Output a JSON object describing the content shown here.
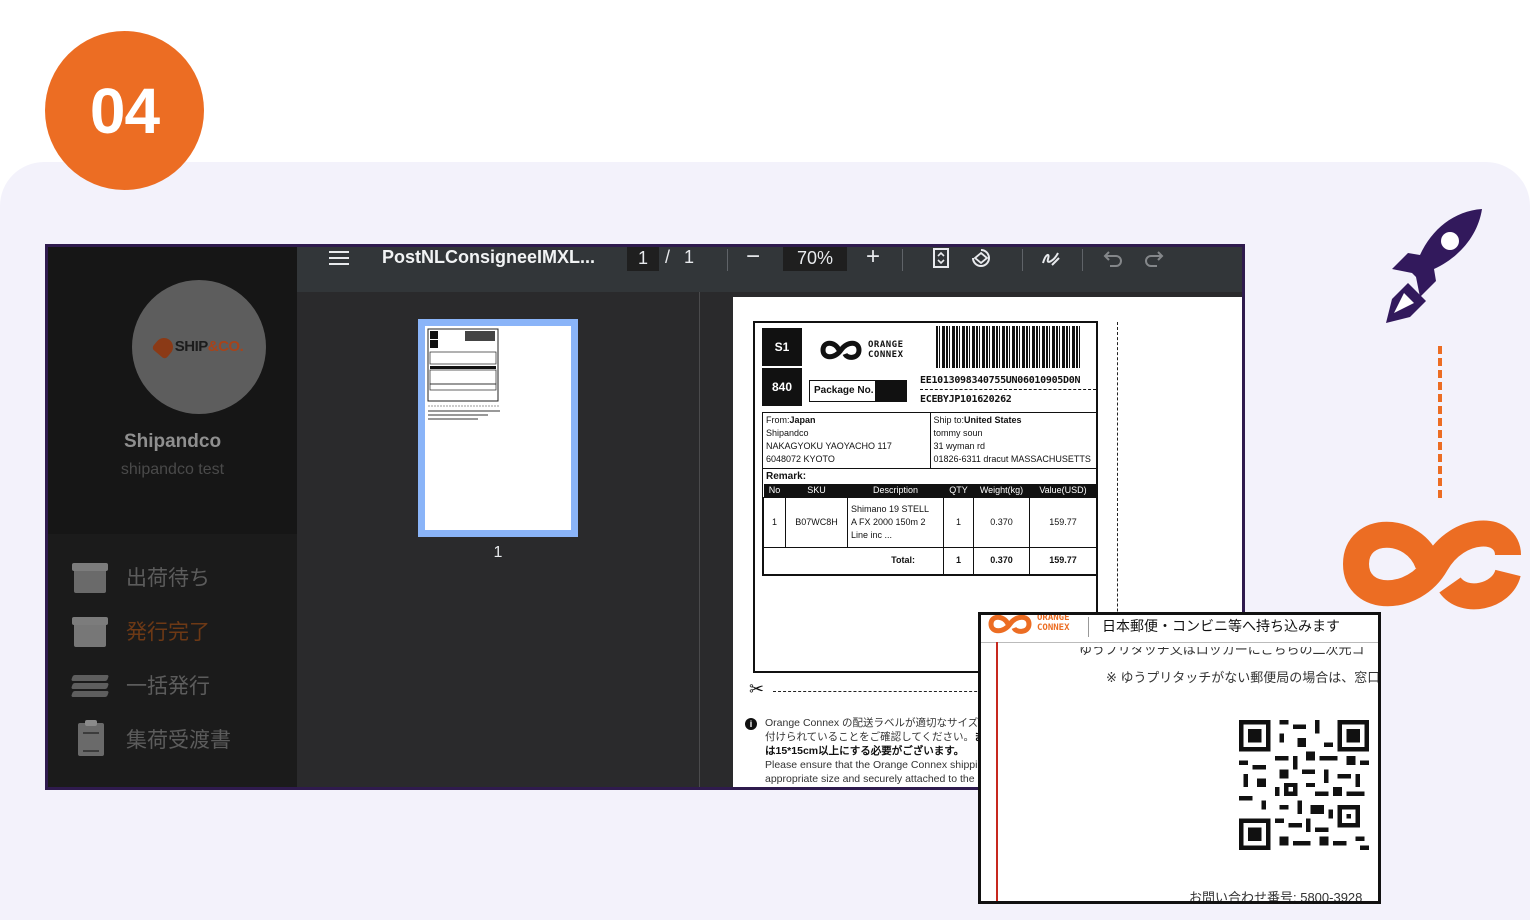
{
  "step": {
    "number": "04"
  },
  "sidebar": {
    "logo_text": "SHIP",
    "logo_amp": "&CO.",
    "user_name": "Shipandco",
    "user_sub": "shipandco test",
    "items": [
      {
        "label": "出荷待ち",
        "icon": "pending-box-icon",
        "active": false
      },
      {
        "label": "発行完了",
        "icon": "issued-box-icon",
        "active": true
      },
      {
        "label": "一括発行",
        "icon": "bulk-stack-icon",
        "active": false
      },
      {
        "label": "集荷受渡書",
        "icon": "clipboard-icon",
        "active": false
      }
    ]
  },
  "toolbar": {
    "menu_icon": "hamburger-menu-icon",
    "file_title": "PostNLConsigneeIMXL...",
    "current_page": "1",
    "separator": "/",
    "total_pages": "1",
    "zoom_out": "−",
    "zoom": "70%",
    "zoom_in": "+"
  },
  "thumbnails": {
    "page_number": "1"
  },
  "label": {
    "s1": "S1",
    "code": "840",
    "brand_line1": "ORANGE",
    "brand_line2": "CONNEX",
    "package_no_label": "Package No.",
    "tracking1": "EE1013098340755UN06010905D0N",
    "tracking2": "ECEBYJP101620262",
    "from_label": "From:",
    "from_country": "Japan",
    "from_lines": [
      "Shipandco",
      "NAKAGYOKU YAOYACHO 117",
      "6048072 KYOTO"
    ],
    "to_label": "Ship to:",
    "to_country": "United States",
    "to_lines": [
      "tommy soun",
      "31 wyman rd",
      "01826-6311 dracut MASSACHUSETTS"
    ],
    "remark": "Remark:",
    "headers": [
      "No",
      "SKU",
      "Description",
      "QTY",
      "Weight(kg)",
      "Value(USD)"
    ],
    "item": {
      "no": "1",
      "sku": "B07WC8H",
      "desc1": "Shimano 19 STELL",
      "desc2": "A FX 2000 150m 2",
      "desc3": "Line inc ...",
      "qty": "1",
      "weight": "0.370",
      "value": "159.77"
    },
    "total_label": "Total:",
    "total_qty": "1",
    "total_weight": "0.370",
    "total_value": "159.77"
  },
  "notice": {
    "line1": "Orange Connex の配送ラベルが適切なサイズで",
    "line2_a": "付けられていることをご確認してください。",
    "line2_b": "ま",
    "line3": "は15*15cm以上にする必要がございます。",
    "line4": "Please ensure that the Orange Connex shipping",
    "line5": "appropriate size and securely attached to the p"
  },
  "zoom_card": {
    "brand_line1": "ORANGE",
    "brand_line2": "CONNEX",
    "title": "日本郵便・コンビニ等へ持ち込みます",
    "line1": "ゆうプリタッチ又はロッカーにこちらの二次元コ",
    "line2": "※ ゆうプリタッチがない郵便局の場合は、窓口担当",
    "footer": "お問い合わせ番号: 5800-3928"
  },
  "colors": {
    "accent_orange": "#ec6d23",
    "rocket_purple": "#32195c",
    "panel_bg": "#f3f2fb",
    "pdf_toolbar": "#323639",
    "thumb_highlight": "#8ab4f8"
  }
}
